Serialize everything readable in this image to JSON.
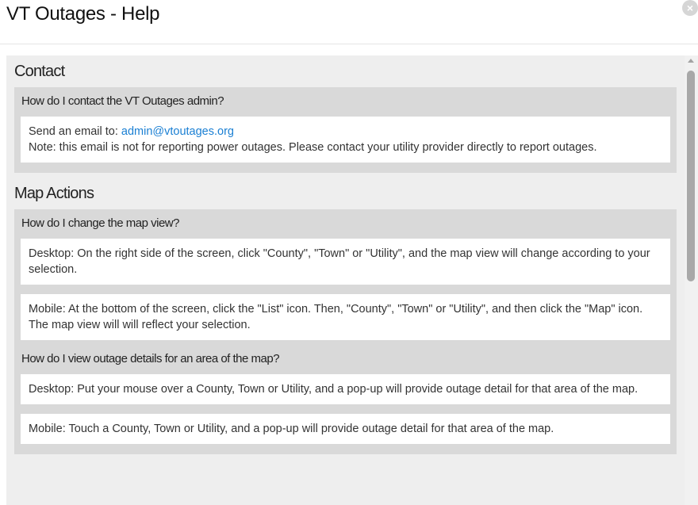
{
  "dialog": {
    "title": "VT Outages - Help",
    "close_glyph": "×"
  },
  "contact": {
    "heading": "Contact",
    "question": "How do I contact the VT Outages admin?",
    "email_prefix": "Send an email to: ",
    "email": "admin@vtoutages.org",
    "note": "Note: this email is not for reporting power outages. Please contact your utility provider directly to report outages."
  },
  "map_actions": {
    "heading": "Map Actions",
    "q1": {
      "question": "How do I change the map view?",
      "desktop": "Desktop: On the right side of the screen, click \"County\", \"Town\" or \"Utility\", and the map view will change according to your selection.",
      "mobile": "Mobile: At the bottom of the screen, click the \"List\" icon. Then, \"County\", \"Town\" or \"Utility\", and then click the \"Map\" icon. The map view will will reflect your selection."
    },
    "q2": {
      "question": "How do I view outage details for an area of the map?",
      "desktop": "Desktop: Put your mouse over a County, Town or Utility, and a pop-up will provide outage detail for that area of the map.",
      "mobile": "Mobile: Touch a County, Town or Utility, and a pop-up will provide outage detail for that area of the map."
    }
  },
  "colors": {
    "link": "#1a7fd3",
    "panel_bg": "#eeeeee",
    "question_bg": "#d9d9d9",
    "answer_bg": "#ffffff"
  }
}
